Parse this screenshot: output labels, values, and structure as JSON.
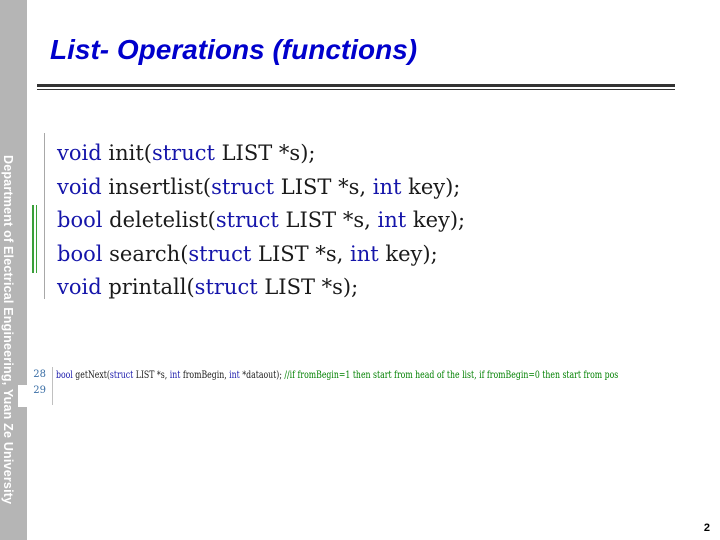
{
  "sidebar": {
    "text": "Department of Electrical Engineering, Yuan Ze University"
  },
  "slide": {
    "title": "List- Operations (functions)",
    "page_number": "2"
  },
  "code_large": {
    "lines": [
      {
        "ret": "void",
        "name": "init(",
        "kw_struct": "struct",
        "rest1": " LIST *s",
        "kw_int": "",
        "rest2": ");"
      },
      {
        "ret": "void",
        "name": "insertlist(",
        "kw_struct": "struct",
        "rest1": " LIST *s, ",
        "kw_int": "int",
        "rest2": " key);"
      },
      {
        "ret": "bool",
        "name": "deletelist(",
        "kw_struct": "struct",
        "rest1": " LIST *s, ",
        "kw_int": "int",
        "rest2": " key);"
      },
      {
        "ret": "bool",
        "name": "search(",
        "kw_struct": "struct",
        "rest1": " LIST *s, ",
        "kw_int": "int",
        "rest2": " key);"
      },
      {
        "ret": "void",
        "name": "printall(",
        "kw_struct": "struct",
        "rest1": " LIST *s",
        "kw_int": "",
        "rest2": ");"
      }
    ]
  },
  "code_small": {
    "line_numbers": [
      "28",
      "29"
    ],
    "kw_bool": "bool",
    "p1": " getNext(",
    "kw_struct": "struct",
    "p2": " LIST *s, ",
    "kw_int1": "int",
    "p3": " fromBegin, ",
    "kw_int2": "int",
    "p4": " *dataout); ",
    "comment": "//if fromBegin=1 then start from head of the list, if fromBegin=0 then start from pos"
  }
}
